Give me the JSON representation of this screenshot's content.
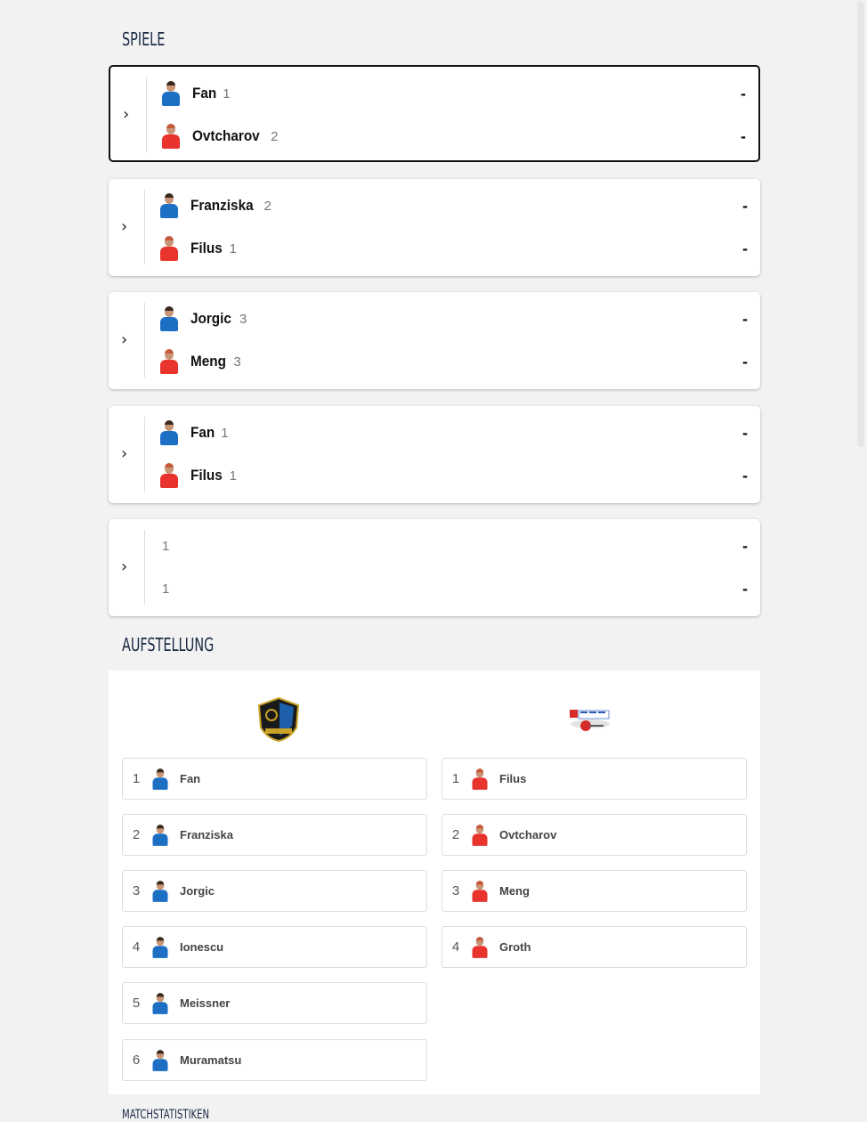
{
  "sections": {
    "games_title": "SPIELE",
    "lineup_title": "AUFSTELLUNG",
    "stats_title": "MATCHSTATISTIKEN"
  },
  "matches": [
    {
      "home": {
        "name": "Fan",
        "seed": "1"
      },
      "away": {
        "name": "Ovtcharov",
        "seed": "2"
      },
      "home_score": "-",
      "away_score": "-",
      "active": true
    },
    {
      "home": {
        "name": "Franziska",
        "seed": "2"
      },
      "away": {
        "name": "Filus",
        "seed": "1"
      },
      "home_score": "-",
      "away_score": "-"
    },
    {
      "home": {
        "name": "Jorgic",
        "seed": "3"
      },
      "away": {
        "name": "Meng",
        "seed": "3"
      },
      "home_score": "-",
      "away_score": "-"
    },
    {
      "home": {
        "name": "Fan",
        "seed": "1"
      },
      "away": {
        "name": "Filus",
        "seed": "1"
      },
      "home_score": "-",
      "away_score": "-"
    },
    {
      "home": {
        "name": "",
        "seed": "1"
      },
      "away": {
        "name": "",
        "seed": "1"
      },
      "home_score": "-",
      "away_score": "-"
    }
  ],
  "chevron": "›",
  "lineup": {
    "home": [
      {
        "num": "1",
        "name": "Fan"
      },
      {
        "num": "2",
        "name": "Franziska"
      },
      {
        "num": "3",
        "name": "Jorgic"
      },
      {
        "num": "4",
        "name": "Ionescu"
      },
      {
        "num": "5",
        "name": "Meissner"
      },
      {
        "num": "6",
        "name": "Muramatsu"
      }
    ],
    "away": [
      {
        "num": "1",
        "name": "Filus"
      },
      {
        "num": "2",
        "name": "Ovtcharov"
      },
      {
        "num": "3",
        "name": "Meng"
      },
      {
        "num": "4",
        "name": "Groth"
      }
    ]
  },
  "colors": {
    "home_jersey": "#1d6fc4",
    "away_jersey": "#e8342c",
    "title": "#1a2a44"
  }
}
